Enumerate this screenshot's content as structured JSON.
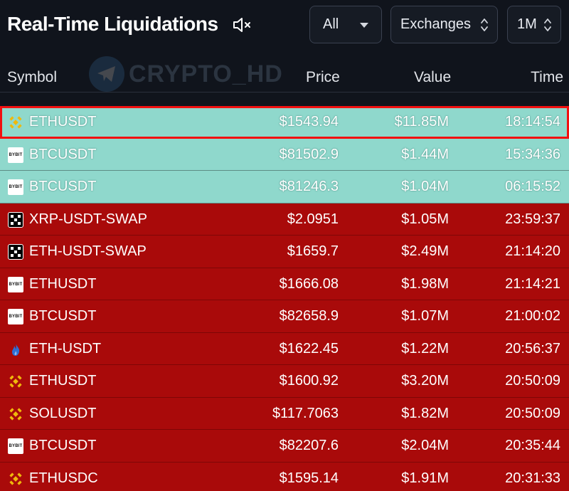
{
  "header": {
    "title": "Real-Time Liquidations",
    "filter_side": "All",
    "filter_exchange": "Exchanges",
    "filter_range": "1M"
  },
  "watermark": "CRYPTO_HD",
  "columns": {
    "symbol": "Symbol",
    "price": "Price",
    "value": "Value",
    "time": "Time"
  },
  "colors": {
    "long_row": "#8fd8cc",
    "short_row": "#a90a0a",
    "highlight_border": "#f21010",
    "binance": "#f0b90b"
  },
  "rows": [
    {
      "exchange_icon": "binance-icon",
      "symbol": "ETHUSDT",
      "price": "$1543.94",
      "value": "$11.85M",
      "time": "18:14:54",
      "side": "long",
      "selected": true
    },
    {
      "exchange_icon": "bybit-icon",
      "exchange_label": "BYBIT",
      "symbol": "BTCUSDT",
      "price": "$81502.9",
      "value": "$1.44M",
      "time": "15:34:36",
      "side": "long"
    },
    {
      "exchange_icon": "bybit-icon",
      "exchange_label": "BYBIT",
      "symbol": "BTCUSDT",
      "price": "$81246.3",
      "value": "$1.04M",
      "time": "06:15:52",
      "side": "long"
    },
    {
      "exchange_icon": "okx-icon",
      "symbol": "XRP-USDT-SWAP",
      "price": "$2.0951",
      "value": "$1.05M",
      "time": "23:59:37",
      "side": "short"
    },
    {
      "exchange_icon": "okx-icon",
      "symbol": "ETH-USDT-SWAP",
      "price": "$1659.7",
      "value": "$2.49M",
      "time": "21:14:20",
      "side": "short"
    },
    {
      "exchange_icon": "bybit-icon",
      "exchange_label": "BYBIT",
      "symbol": "ETHUSDT",
      "price": "$1666.08",
      "value": "$1.98M",
      "time": "21:14:21",
      "side": "short"
    },
    {
      "exchange_icon": "bybit-icon",
      "exchange_label": "BYBIT",
      "symbol": "BTCUSDT",
      "price": "$82658.9",
      "value": "$1.07M",
      "time": "21:00:02",
      "side": "short"
    },
    {
      "exchange_icon": "huobi-flame-icon",
      "symbol": "ETH-USDT",
      "price": "$1622.45",
      "value": "$1.22M",
      "time": "20:56:37",
      "side": "short"
    },
    {
      "exchange_icon": "binance-icon",
      "symbol": "ETHUSDT",
      "price": "$1600.92",
      "value": "$3.20M",
      "time": "20:50:09",
      "side": "short"
    },
    {
      "exchange_icon": "binance-icon",
      "symbol": "SOLUSDT",
      "price": "$117.7063",
      "value": "$1.82M",
      "time": "20:50:09",
      "side": "short"
    },
    {
      "exchange_icon": "bybit-icon",
      "exchange_label": "BYBIT",
      "symbol": "BTCUSDT",
      "price": "$82207.6",
      "value": "$2.04M",
      "time": "20:35:44",
      "side": "short"
    },
    {
      "exchange_icon": "binance-icon",
      "symbol": "ETHUSDC",
      "price": "$1595.14",
      "value": "$1.91M",
      "time": "20:31:33",
      "side": "short"
    }
  ]
}
